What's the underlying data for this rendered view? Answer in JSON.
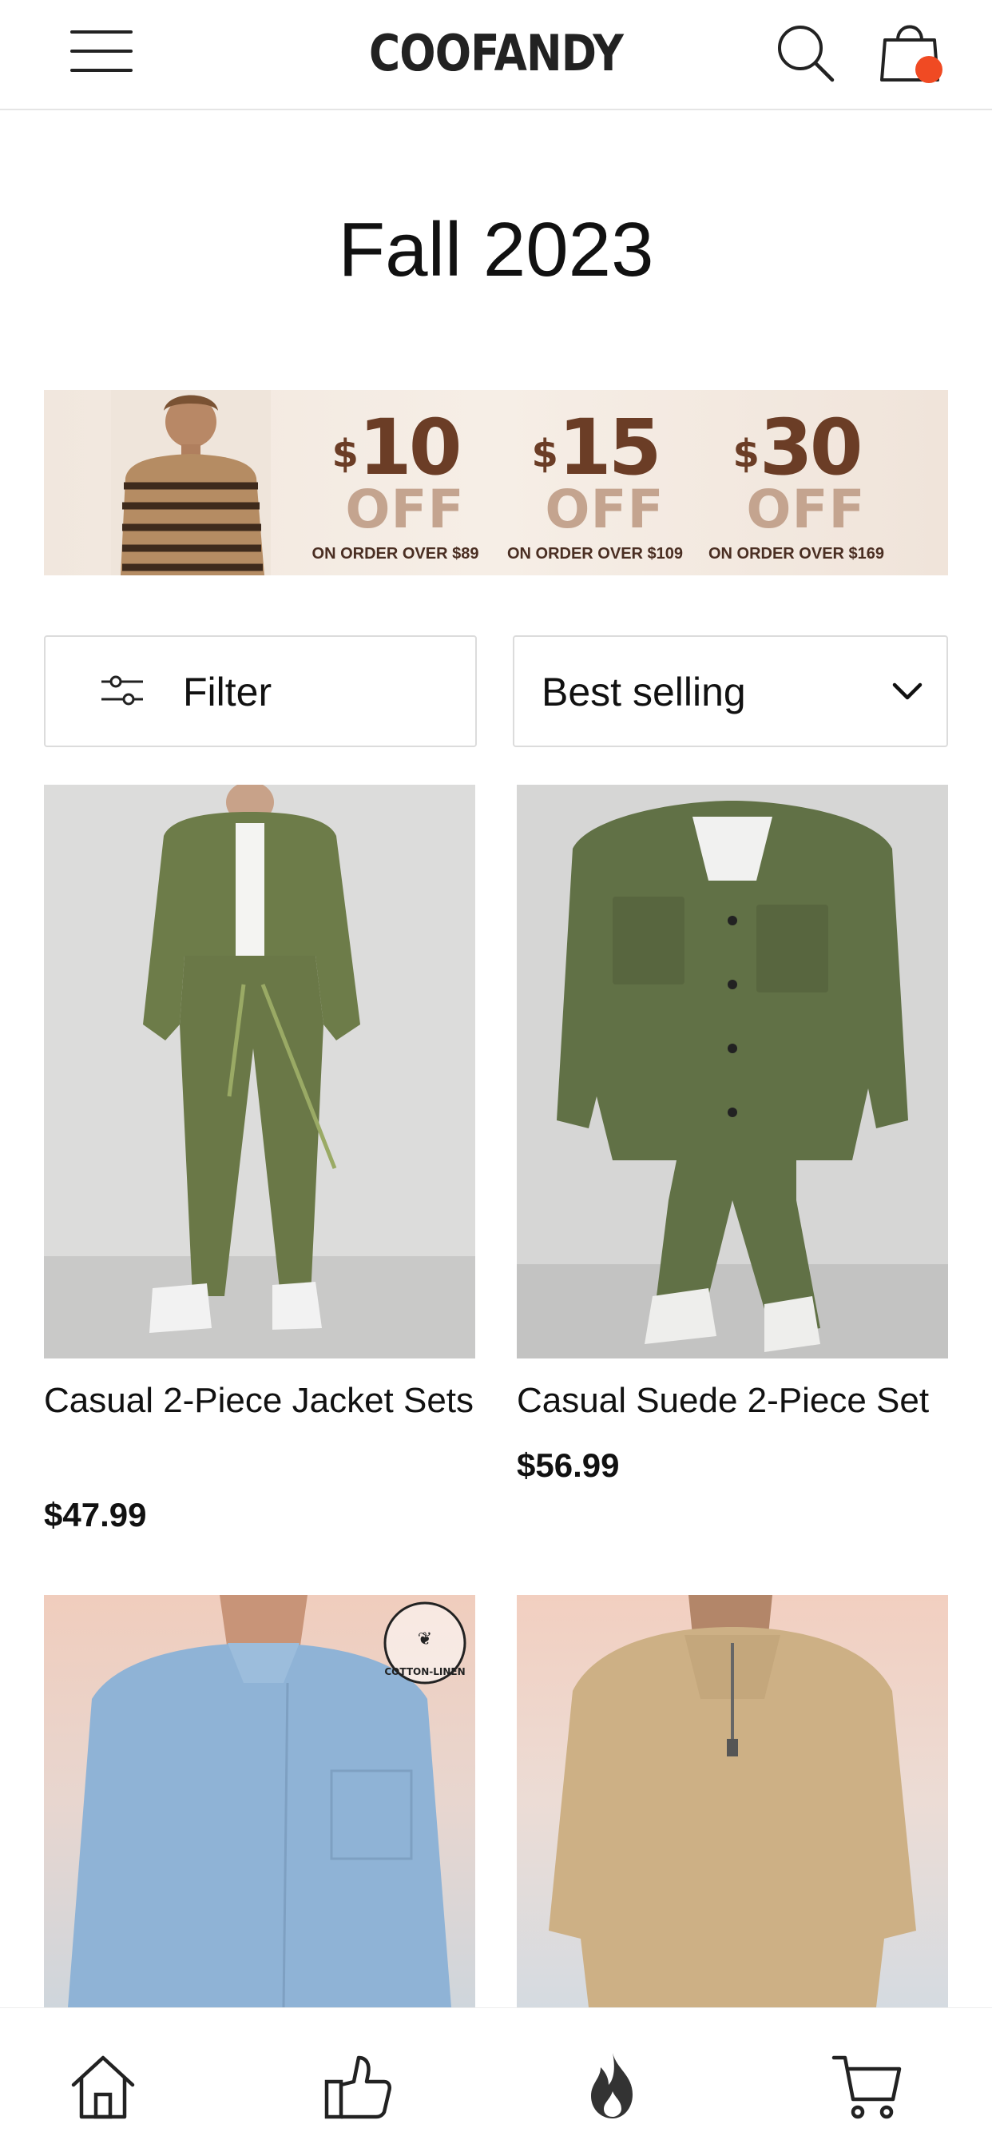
{
  "header": {
    "brand": "COOFANDY",
    "menu_icon": "hamburger-menu-icon",
    "search_icon": "search-icon",
    "cart_icon": "shopping-bag-icon",
    "cart_badge_color": "#f04a23"
  },
  "page": {
    "title": "Fall 2023"
  },
  "promo_banner": {
    "offers": [
      {
        "currency": "$",
        "amount": "10",
        "off": "OFF",
        "condition": "ON ORDER OVER $89"
      },
      {
        "currency": "$",
        "amount": "15",
        "off": "OFF",
        "condition": "ON ORDER OVER $109"
      },
      {
        "currency": "$",
        "amount": "30",
        "off": "OFF",
        "condition": "ON ORDER OVER $169"
      }
    ],
    "accent_color": "#6b3d26"
  },
  "controls": {
    "filter_label": "Filter",
    "filter_icon": "sliders-icon",
    "sort_label": "Best selling",
    "sort_icon": "chevron-down-icon"
  },
  "products": [
    {
      "name": "Casual 2-Piece Jacket Sets",
      "price": "$47.99"
    },
    {
      "name": "Casual Suede 2-Piece Set",
      "price": "$56.99"
    },
    {
      "name": "",
      "price": "",
      "badge": "COTTON-LINEN"
    },
    {
      "name": "",
      "price": ""
    }
  ],
  "bottom_nav": [
    {
      "icon": "home-icon"
    },
    {
      "icon": "thumbs-up-icon"
    },
    {
      "icon": "fire-icon"
    },
    {
      "icon": "cart-icon"
    }
  ]
}
